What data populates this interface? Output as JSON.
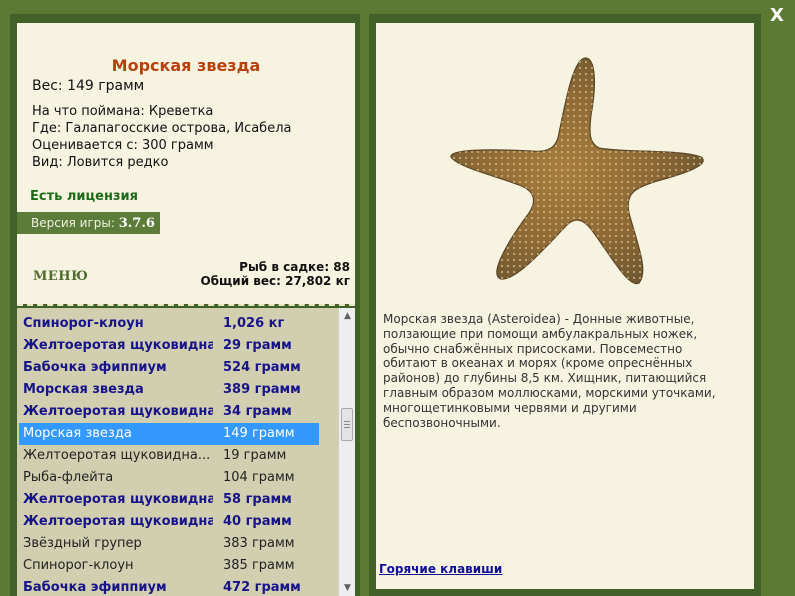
{
  "fish": {
    "title": "Морская звезда",
    "weight": "Вес: 149 грамм",
    "caught_on": "На что поймана: Креветка",
    "location": "Где: Галапагосские острова, Исабела",
    "valued_from": "Оценивается с: 300 грамм",
    "rarity": "Вид: Ловится редко"
  },
  "license": "Есть лицензия",
  "version": {
    "label": "Версия игры:",
    "number": "3.7.6"
  },
  "menu_label": "МЕНЮ",
  "cage": {
    "count": "Рыб в садке: 88",
    "total_weight": "Общий вес: 27,802 кг"
  },
  "catch_list": [
    {
      "name": "Спинорог-клоун",
      "weight": "1,026 кг",
      "style": "bold"
    },
    {
      "name": "Желтоеротая щуковидная",
      "weight": "29 грамм",
      "style": "bold"
    },
    {
      "name": "Бабочка эфиппиум",
      "weight": "524 грамм",
      "style": "bold"
    },
    {
      "name": "Морская звезда",
      "weight": "389 грамм",
      "style": "bold"
    },
    {
      "name": "Желтоеротая щуковидная",
      "weight": "34 грамм",
      "style": "bold"
    },
    {
      "name": "Морская звезда",
      "weight": "149 грамм",
      "style": "sel"
    },
    {
      "name": "Желтоеротая щуковидна...",
      "weight": "19 грамм",
      "style": "plain"
    },
    {
      "name": "Рыба-флейта",
      "weight": "104 грамм",
      "style": "plain"
    },
    {
      "name": "Желтоеротая щуковидна...",
      "weight": "58 грамм",
      "style": "bold"
    },
    {
      "name": "Желтоеротая щуковидна...",
      "weight": "40 грамм",
      "style": "bold"
    },
    {
      "name": "Звёздный групер",
      "weight": "383 грамм",
      "style": "plain"
    },
    {
      "name": "Спинорог-клоун",
      "weight": "385 грамм",
      "style": "plain"
    },
    {
      "name": "Бабочка эфиппиум",
      "weight": "472 грамм",
      "style": "bold"
    }
  ],
  "description": "Морская звезда (Asteroidea) - Донные животные, ползающие при помощи амбулакральных ножек, обычно снабжённых присосками. Повсеместно обитают в океанах и морях (кроме опреснённых районов) до глубины 8,5 км. Хищник, питающийся главным образом моллюсками, морскими уточками, многощетинковыми червями и другими беспозвоночными.",
  "hotkeys_label": "Горячие клавиши",
  "close_label": "X",
  "icons": {
    "scroll_up": "triangle-up-icon",
    "scroll_down": "triangle-down-icon"
  },
  "colors": {
    "background": "#5d7a34",
    "panel_dark": "#416128",
    "paper": "#f6f4e0",
    "title": "#b7410e",
    "list_bold": "#17148a",
    "selection": "#3399ff"
  }
}
